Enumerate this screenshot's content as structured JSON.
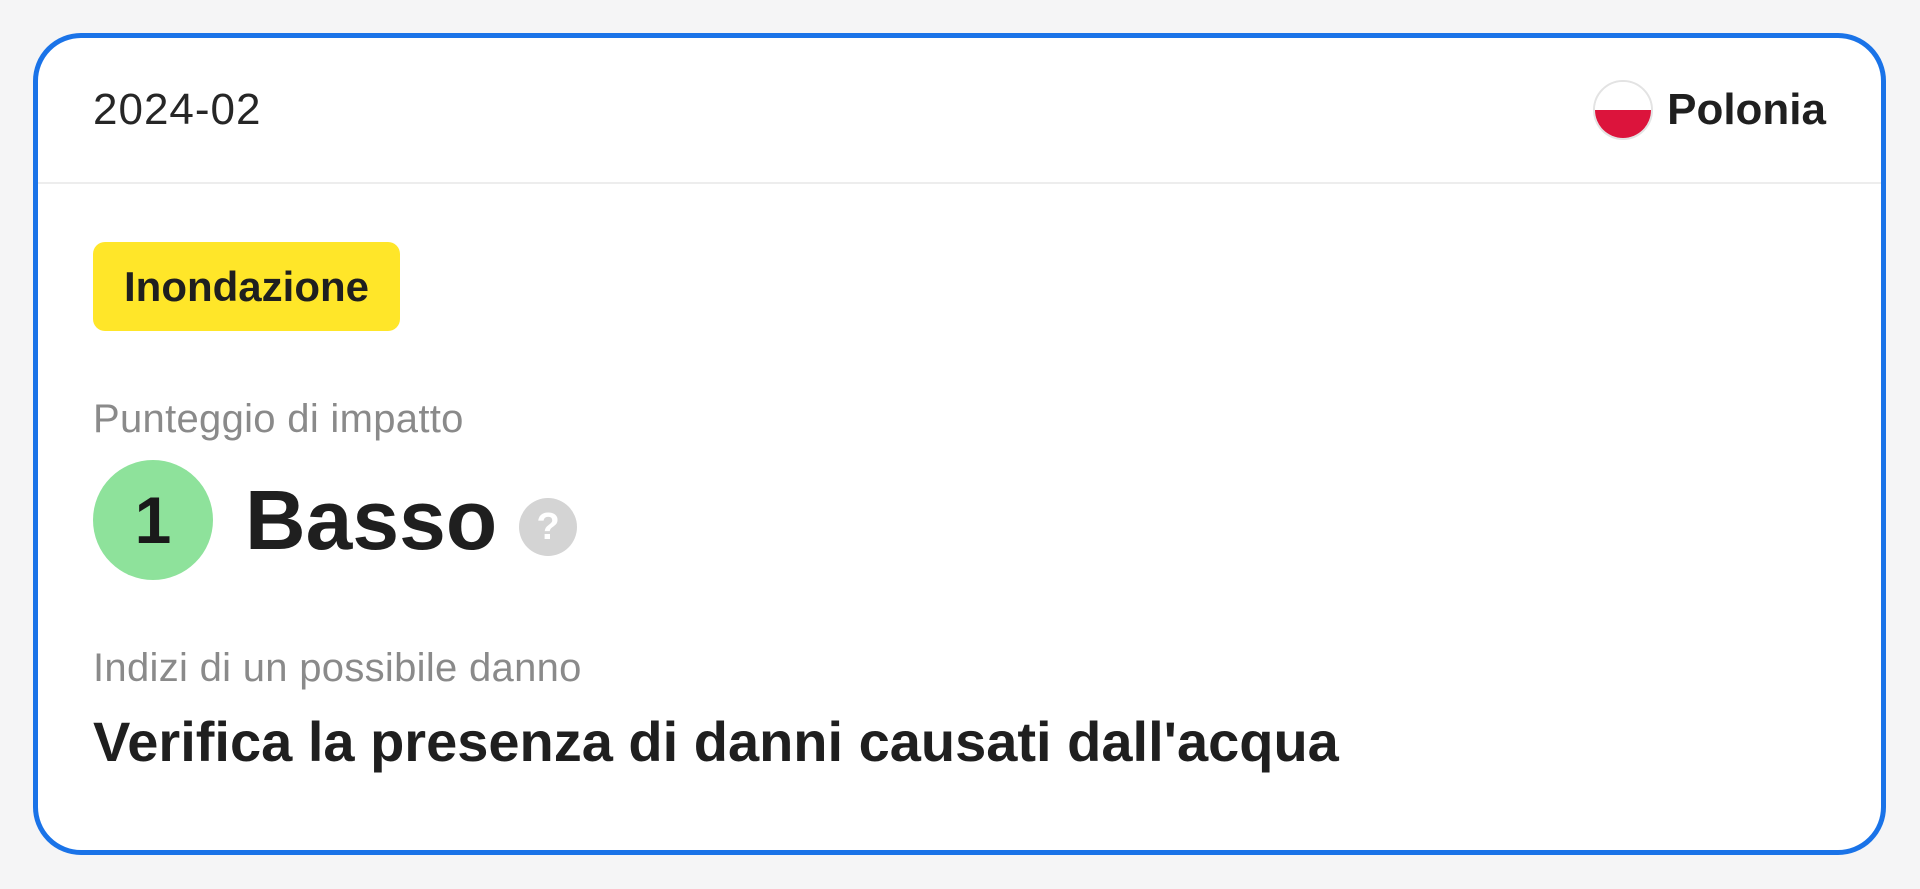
{
  "card": {
    "date": "2024-02",
    "country": {
      "name": "Polonia",
      "flag_icon": "poland-flag-icon",
      "flag_colors": [
        "#ffffff",
        "#dc143c"
      ]
    },
    "event_tag": {
      "label": "Inondazione",
      "color": "#ffe629"
    },
    "impact": {
      "label": "Punteggio di impatto",
      "score": "1",
      "level": "Basso",
      "score_color": "#8ee29b",
      "help_icon": "question-mark-icon",
      "help_glyph": "?"
    },
    "damage": {
      "label": "Indizi di un possibile danno",
      "text": "Verifica la presenza di danni causati dall'acqua"
    },
    "border_color": "#1a73e8"
  }
}
